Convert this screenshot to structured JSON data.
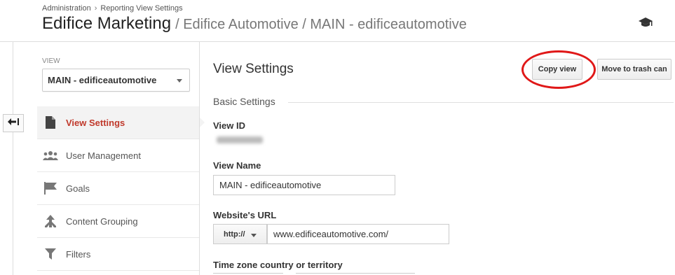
{
  "header": {
    "breadcrumb": [
      "Administration",
      "Reporting View Settings"
    ],
    "breadcrumb_separator": "›",
    "account_name": "Edifice Marketing",
    "property_path": "/ Edifice Automotive / MAIN - edificeautomotive",
    "icon": "graduation-cap-icon"
  },
  "sidebar": {
    "view_label": "VIEW",
    "view_selected": "MAIN - edificeautomotive",
    "items": [
      {
        "label": "View Settings",
        "icon": "document-icon",
        "active": true
      },
      {
        "label": "User Management",
        "icon": "users-icon",
        "active": false
      },
      {
        "label": "Goals",
        "icon": "flag-icon",
        "active": false
      },
      {
        "label": "Content Grouping",
        "icon": "content-grouping-icon",
        "active": false
      },
      {
        "label": "Filters",
        "icon": "filter-icon",
        "active": false
      }
    ]
  },
  "main": {
    "title": "View Settings",
    "copy_button": "Copy view",
    "trash_button": "Move to trash can",
    "section_title": "Basic Settings",
    "view_id_label": "View ID",
    "view_name_label": "View Name",
    "view_name_value": "MAIN - edificeautomotive",
    "website_url_label": "Website's URL",
    "protocol_value": "http://",
    "url_value": "www.edificeautomotive.com/",
    "timezone_label": "Time zone country or territory"
  },
  "colors": {
    "active_nav": "#c0392b",
    "annotation": "#e01818",
    "active_bg": "#f3f3f3"
  }
}
